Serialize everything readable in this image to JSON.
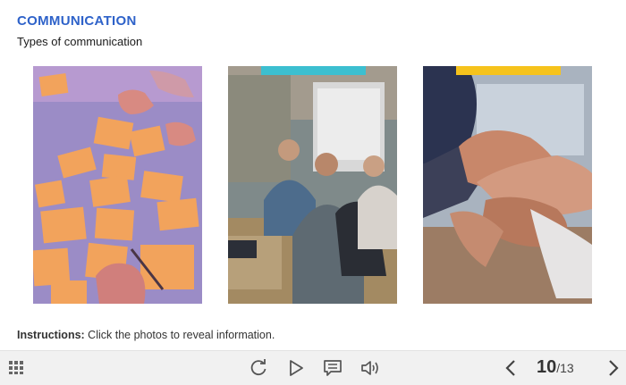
{
  "slide": {
    "title": "COMMUNICATION",
    "subtitle": "Types of communication",
    "instructions_label": "Instructions:",
    "instructions_text": " Click the photos to reveal information."
  },
  "photos": [
    {
      "name": "sticky-notes-photo",
      "accent": null
    },
    {
      "name": "office-meeting-photo",
      "accent": "#3cbfd0"
    },
    {
      "name": "stacked-hands-photo",
      "accent": "#f6c31c"
    }
  ],
  "toolbar": {
    "icons": [
      "menu-grid-icon",
      "replay-icon",
      "play-icon",
      "transcript-icon",
      "volume-icon",
      "prev-arrow-icon",
      "next-arrow-icon"
    ],
    "current_page": "10",
    "total_pages": "/13"
  },
  "colors": {
    "title": "#2e62c9",
    "toolbar_bg": "#f1f1f1",
    "icon": "#555555"
  }
}
